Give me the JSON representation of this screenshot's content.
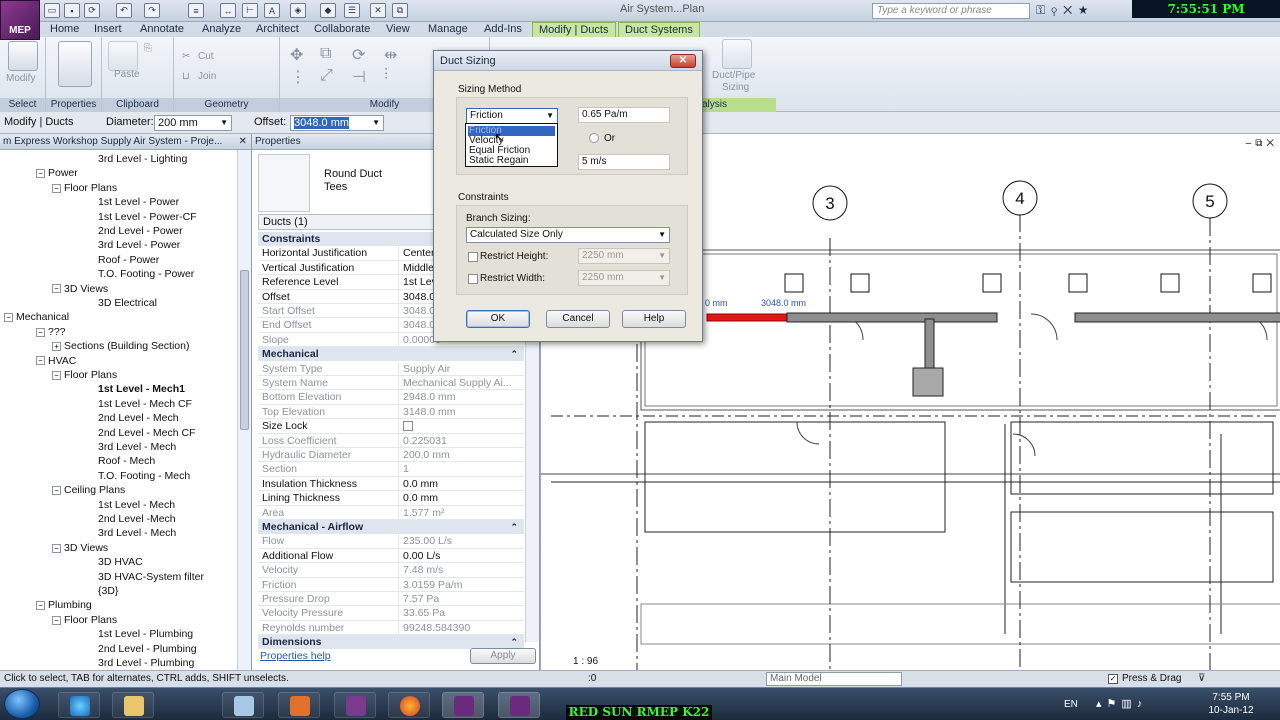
{
  "clock": "7:55:51 PM 01/10/2012",
  "window_title": "Air System...Plan",
  "search_placeholder": "Type a keyword or phrase",
  "app_badge": "MEP",
  "ribbon_tabs": [
    "Home",
    "Insert",
    "Annotate",
    "Analyze",
    "Architect",
    "Collaborate",
    "View",
    "Manage",
    "Add-Ins",
    "Modify | Ducts",
    "Duct Systems"
  ],
  "ribbon_groups": [
    "Select",
    "Properties",
    "Clipboard",
    "Geometry",
    "Modify",
    "alysis"
  ],
  "ribbon_buttons": {
    "modify": "Modify",
    "paste": "Paste",
    "cut": "Cut",
    "join": "Join",
    "ductpipe": "Duct/Pipe",
    "sizing": "Sizing"
  },
  "options_bar": {
    "context": "Modify | Ducts",
    "diameter_label": "Diameter:",
    "diameter_value": "200 mm",
    "offset_label": "Offset:",
    "offset_value": "3048.0 mm"
  },
  "browser": {
    "title": "m Express Workshop Supply Air System - Proje...",
    "items": [
      {
        "label": "3rd Level - Lighting",
        "depth": 4
      },
      {
        "label": "Power",
        "depth": 2,
        "expander": "minus"
      },
      {
        "label": "Floor Plans",
        "depth": 3,
        "expander": "minus"
      },
      {
        "label": "1st Level - Power",
        "depth": 4
      },
      {
        "label": "1st Level - Power-CF",
        "depth": 4
      },
      {
        "label": "2nd Level - Power",
        "depth": 4
      },
      {
        "label": "3rd Level - Power",
        "depth": 4
      },
      {
        "label": "Roof - Power",
        "depth": 4
      },
      {
        "label": "T.O. Footing - Power",
        "depth": 4
      },
      {
        "label": "3D Views",
        "depth": 3,
        "expander": "minus"
      },
      {
        "label": "3D Electrical",
        "depth": 4
      },
      {
        "label": "Mechanical",
        "depth": 1,
        "expander": "minus"
      },
      {
        "label": "???",
        "depth": 2,
        "expander": "minus"
      },
      {
        "label": "Sections (Building Section)",
        "depth": 3,
        "expander": "plus"
      },
      {
        "label": "HVAC",
        "depth": 2,
        "expander": "minus"
      },
      {
        "label": "Floor Plans",
        "depth": 3,
        "expander": "minus"
      },
      {
        "label": "1st Level - Mech1",
        "depth": 4,
        "bold": true
      },
      {
        "label": "1st Level - Mech CF",
        "depth": 4
      },
      {
        "label": "2nd Level - Mech",
        "depth": 4
      },
      {
        "label": "2nd Level - Mech CF",
        "depth": 4
      },
      {
        "label": "3rd Level - Mech",
        "depth": 4
      },
      {
        "label": "Roof - Mech",
        "depth": 4
      },
      {
        "label": "T.O. Footing - Mech",
        "depth": 4
      },
      {
        "label": "Ceiling Plans",
        "depth": 3,
        "expander": "minus"
      },
      {
        "label": "1st Level - Mech",
        "depth": 4
      },
      {
        "label": "2nd Level -Mech",
        "depth": 4
      },
      {
        "label": "3rd Level - Mech",
        "depth": 4
      },
      {
        "label": "3D Views",
        "depth": 3,
        "expander": "minus"
      },
      {
        "label": "3D HVAC",
        "depth": 4
      },
      {
        "label": "3D HVAC-System filter",
        "depth": 4
      },
      {
        "label": "{3D}",
        "depth": 4
      },
      {
        "label": "Plumbing",
        "depth": 2,
        "expander": "minus"
      },
      {
        "label": "Floor Plans",
        "depth": 3,
        "expander": "minus"
      },
      {
        "label": "1st Level - Plumbing",
        "depth": 4
      },
      {
        "label": "2nd Level - Plumbing",
        "depth": 4
      },
      {
        "label": "3rd Level - Plumbing",
        "depth": 4
      }
    ]
  },
  "properties": {
    "title": "Properties",
    "type_name": "Round Duct\nTees",
    "instance": "Ducts (1)",
    "help_link": "Properties help",
    "apply": "Apply",
    "rows": [
      {
        "cat": "Constraints"
      },
      {
        "k": "Horizontal Justification",
        "v": "Center"
      },
      {
        "k": "Vertical Justification",
        "v": "Middle"
      },
      {
        "k": "Reference Level",
        "v": "1st Level"
      },
      {
        "k": "Offset",
        "v": "3048.0"
      },
      {
        "k": "Start Offset",
        "v": "3048.0",
        "grey": true
      },
      {
        "k": "End Offset",
        "v": "3048.0",
        "grey": true
      },
      {
        "k": "Slope",
        "v": "0.00000",
        "grey": true
      },
      {
        "cat": "Mechanical"
      },
      {
        "k": "System Type",
        "v": "Supply Air",
        "grey": true
      },
      {
        "k": "System Name",
        "v": "Mechanical Supply Ai...",
        "grey": true
      },
      {
        "k": "Bottom Elevation",
        "v": "2948.0 mm",
        "grey": true
      },
      {
        "k": "Top Elevation",
        "v": "3148.0 mm",
        "grey": true
      },
      {
        "k": "Size Lock",
        "v": "",
        "checkbox": true
      },
      {
        "k": "Loss Coefficient",
        "v": "0.225031",
        "grey": true
      },
      {
        "k": "Hydraulic Diameter",
        "v": "200.0 mm",
        "grey": true
      },
      {
        "k": "Section",
        "v": "1",
        "grey": true
      },
      {
        "k": "Insulation Thickness",
        "v": "0.0 mm"
      },
      {
        "k": "Lining Thickness",
        "v": "0.0 mm"
      },
      {
        "k": "Area",
        "v": "1.577 m²",
        "grey": true
      },
      {
        "cat": "Mechanical - Airflow"
      },
      {
        "k": "Flow",
        "v": "235.00 L/s",
        "grey": true
      },
      {
        "k": "Additional Flow",
        "v": "0.00 L/s"
      },
      {
        "k": "Velocity",
        "v": "7.48 m/s",
        "grey": true
      },
      {
        "k": "Friction",
        "v": "3.0159 Pa/m",
        "grey": true
      },
      {
        "k": "Pressure Drop",
        "v": "7.57 Pa",
        "grey": true
      },
      {
        "k": "Velocity Pressure",
        "v": "33.65 Pa",
        "grey": true
      },
      {
        "k": "Reynolds number",
        "v": "99248.584390",
        "grey": true
      },
      {
        "cat": "Dimensions"
      }
    ]
  },
  "dialog": {
    "title": "Duct Sizing",
    "sizing_method_label": "Sizing Method",
    "method_value": "Friction",
    "friction_value": "0.65 Pa/m",
    "or_label": "Or",
    "velocity_value": "5 m/s",
    "constraints_label": "Constraints",
    "branch_label": "Branch Sizing:",
    "branch_value": "Calculated Size Only",
    "restrict_height_label": "Restrict Height:",
    "restrict_height_value": "2250 mm",
    "restrict_width_label": "Restrict Width:",
    "restrict_width_value": "2250 mm",
    "ok": "OK",
    "cancel": "Cancel",
    "help": "Help",
    "options": [
      "Friction",
      "Velocity",
      "Equal Friction",
      "Static Regain"
    ]
  },
  "view": {
    "grid_labels": [
      "3",
      "4",
      "5"
    ],
    "dim_left": "0 mm",
    "dim_right": "3048.0 mm",
    "scale": "1 : 96"
  },
  "status": {
    "hint": "Click to select, TAB for alternates, CTRL adds, SHIFT unselects.",
    "model": "Main Model",
    "press_drag": "Press & Drag",
    "counter": ":0"
  },
  "taskbar": {
    "lang": "EN",
    "time": "7:55 PM",
    "date": "10-Jan-12",
    "watermark": "RED SUN RMEP K22"
  },
  "colors": {
    "selected_duct": "#e01818",
    "context_tab": "#c9e6a0",
    "clock_text": "#2fff2f"
  }
}
